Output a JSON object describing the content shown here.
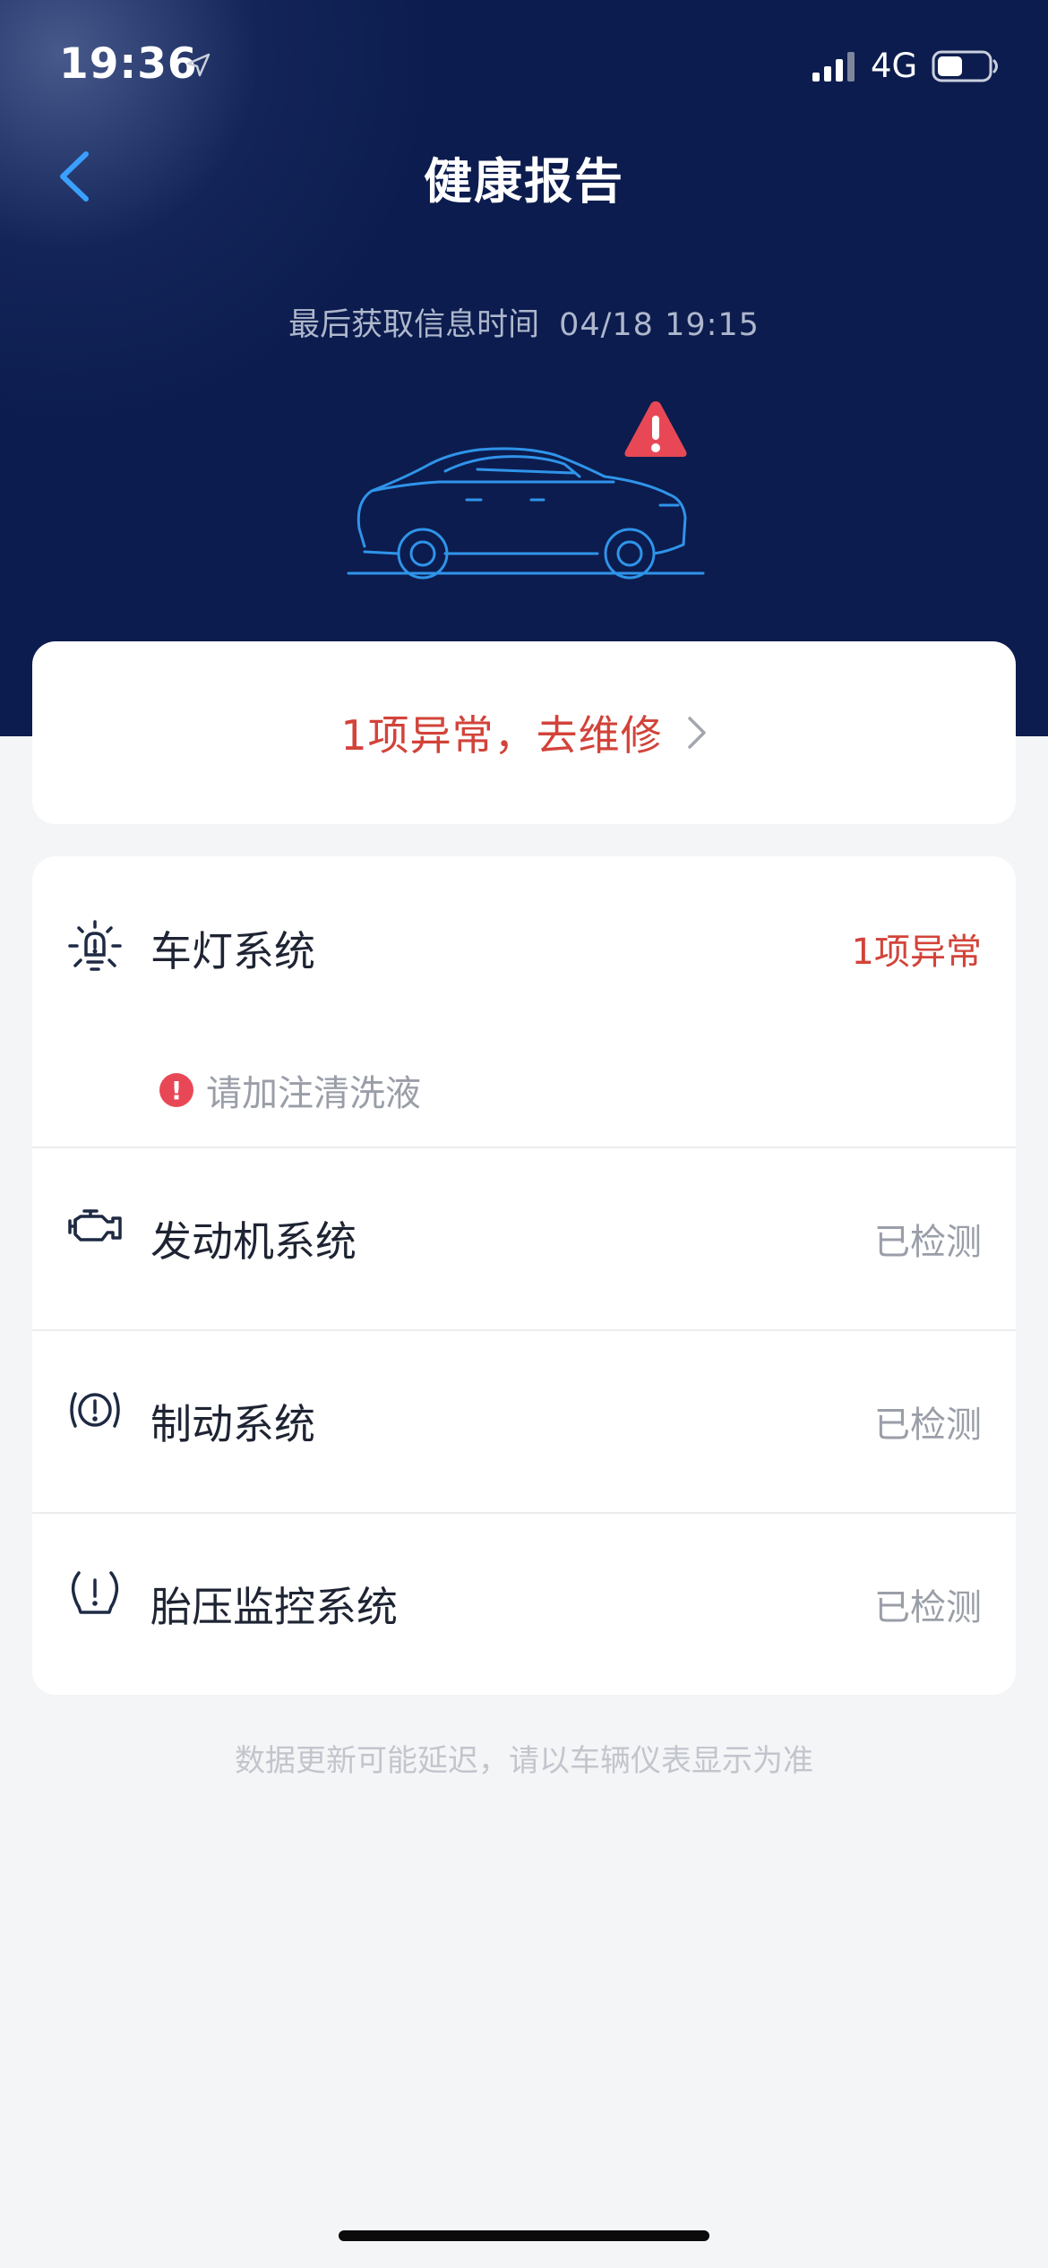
{
  "status_bar": {
    "time": "19:36",
    "network": "4G",
    "battery_level": 0.5
  },
  "header": {
    "title": "健康报告",
    "last_update_label": "最后获取信息时间",
    "last_update_time": "04/18 19:15"
  },
  "summary": {
    "repair_text": "1项异常，去维修"
  },
  "systems": [
    {
      "label": "车灯系统",
      "status": "1项异常",
      "icon": "headlight-icon",
      "alerts": [
        "请加注清洗液"
      ]
    },
    {
      "label": "发动机系统",
      "status": "已检测",
      "icon": "engine-icon"
    },
    {
      "label": "制动系统",
      "status": "已检测",
      "icon": "brake-icon"
    },
    {
      "label": "胎压监控系统",
      "status": "已检测",
      "icon": "tire-pressure-icon"
    }
  ],
  "footnote": "数据更新可能延迟，请以车辆仪表显示为准",
  "colors": {
    "header_bg": "#0c1c4e",
    "accent_blue": "#3aa0ff",
    "error_red": "#d2433a",
    "alert_dot": "#e84856"
  }
}
